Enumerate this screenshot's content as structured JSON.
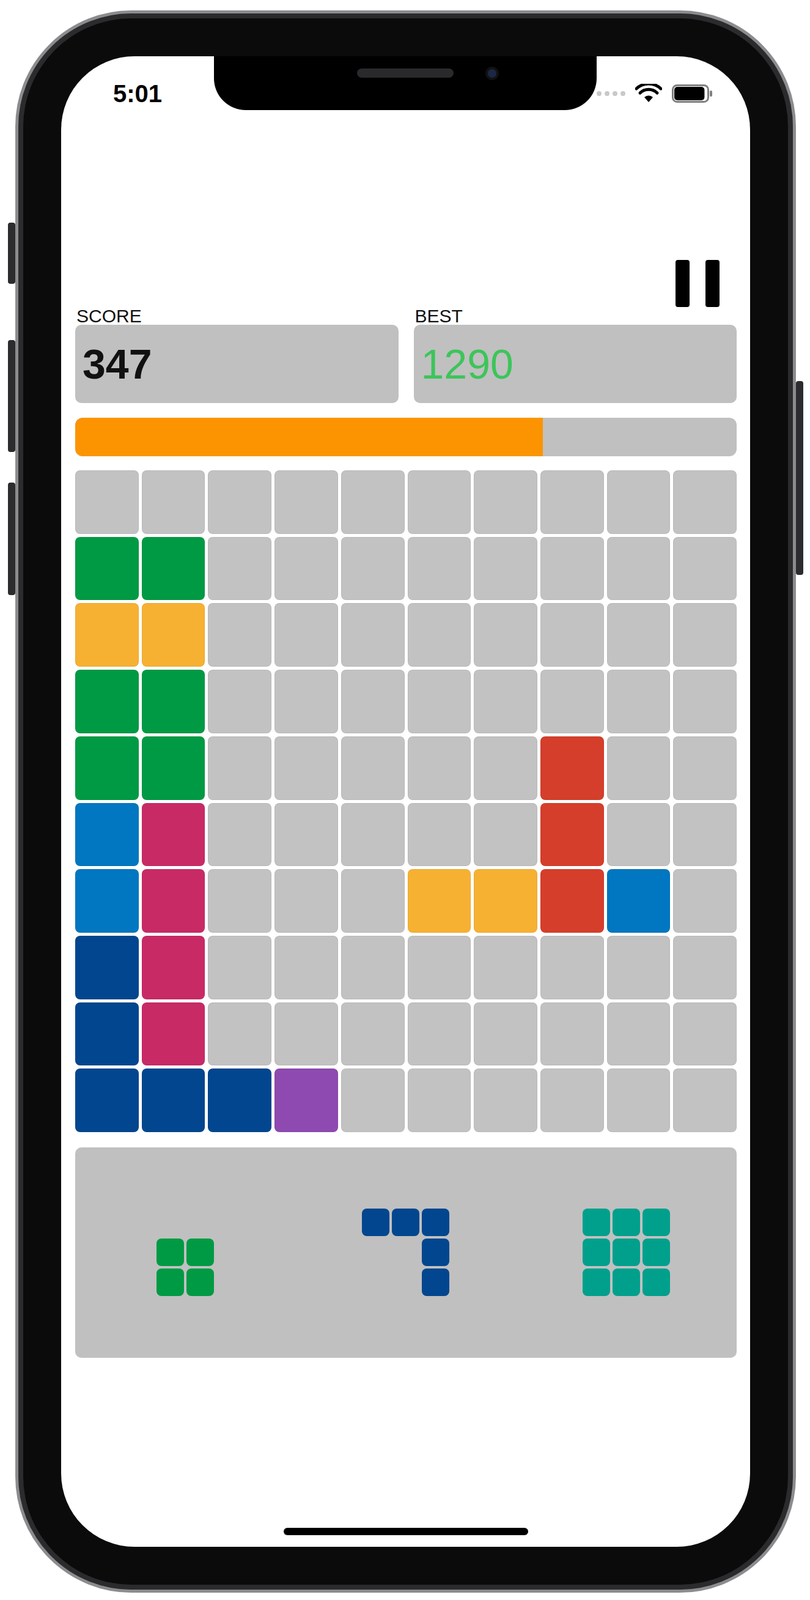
{
  "status_bar": {
    "time": "5:01",
    "battery": {
      "level": 0.95
    }
  },
  "score": {
    "label": "SCORE",
    "value": "347"
  },
  "best": {
    "label": "BEST",
    "value": "1290"
  },
  "progress": {
    "level": 0.707
  },
  "board": {
    "rows": [
      [
        {
          "filled": false
        },
        {
          "filled": false
        },
        {
          "filled": false
        },
        {
          "filled": false
        },
        {
          "filled": false
        },
        {
          "filled": false
        },
        {
          "filled": false
        },
        {
          "filled": false
        },
        {
          "filled": false
        },
        {
          "filled": false
        }
      ],
      [
        {
          "filled": true,
          "color": "#009a44"
        },
        {
          "filled": true,
          "color": "#009a44"
        },
        {
          "filled": false
        },
        {
          "filled": false
        },
        {
          "filled": false
        },
        {
          "filled": false
        },
        {
          "filled": false
        },
        {
          "filled": false
        },
        {
          "filled": false
        },
        {
          "filled": false
        }
      ],
      [
        {
          "filled": true,
          "color": "#f6b133"
        },
        {
          "filled": true,
          "color": "#f6b133"
        },
        {
          "filled": false
        },
        {
          "filled": false
        },
        {
          "filled": false
        },
        {
          "filled": false
        },
        {
          "filled": false
        },
        {
          "filled": false
        },
        {
          "filled": false
        },
        {
          "filled": false
        }
      ],
      [
        {
          "filled": true,
          "color": "#009a44"
        },
        {
          "filled": true,
          "color": "#009a44"
        },
        {
          "filled": false
        },
        {
          "filled": false
        },
        {
          "filled": false
        },
        {
          "filled": false
        },
        {
          "filled": false
        },
        {
          "filled": false
        },
        {
          "filled": false
        },
        {
          "filled": false
        }
      ],
      [
        {
          "filled": true,
          "color": "#009a44"
        },
        {
          "filled": true,
          "color": "#009a44"
        },
        {
          "filled": false
        },
        {
          "filled": false
        },
        {
          "filled": false
        },
        {
          "filled": false
        },
        {
          "filled": false
        },
        {
          "filled": true,
          "color": "#d53e2b"
        },
        {
          "filled": false
        },
        {
          "filled": false
        }
      ],
      [
        {
          "filled": true,
          "color": "#0077c0"
        },
        {
          "filled": true,
          "color": "#c82a66"
        },
        {
          "filled": false
        },
        {
          "filled": false
        },
        {
          "filled": false
        },
        {
          "filled": false
        },
        {
          "filled": false
        },
        {
          "filled": true,
          "color": "#d53e2b"
        },
        {
          "filled": false
        },
        {
          "filled": false
        }
      ],
      [
        {
          "filled": true,
          "color": "#0077c0"
        },
        {
          "filled": true,
          "color": "#c82a66"
        },
        {
          "filled": false
        },
        {
          "filled": false
        },
        {
          "filled": false
        },
        {
          "filled": true,
          "color": "#f6b133"
        },
        {
          "filled": true,
          "color": "#f6b133"
        },
        {
          "filled": true,
          "color": "#d53e2b"
        },
        {
          "filled": true,
          "color": "#0077c0"
        },
        {
          "filled": false
        }
      ],
      [
        {
          "filled": true,
          "color": "#02468f"
        },
        {
          "filled": true,
          "color": "#c82a66"
        },
        {
          "filled": false
        },
        {
          "filled": false
        },
        {
          "filled": false
        },
        {
          "filled": false
        },
        {
          "filled": false
        },
        {
          "filled": false
        },
        {
          "filled": false
        },
        {
          "filled": false
        }
      ],
      [
        {
          "filled": true,
          "color": "#02468f"
        },
        {
          "filled": true,
          "color": "#c82a66"
        },
        {
          "filled": false
        },
        {
          "filled": false
        },
        {
          "filled": false
        },
        {
          "filled": false
        },
        {
          "filled": false
        },
        {
          "filled": false
        },
        {
          "filled": false
        },
        {
          "filled": false
        }
      ],
      [
        {
          "filled": true,
          "color": "#02468f"
        },
        {
          "filled": true,
          "color": "#02468f"
        },
        {
          "filled": true,
          "color": "#02468f"
        },
        {
          "filled": true,
          "color": "#8e4ab0"
        },
        {
          "filled": false
        },
        {
          "filled": false
        },
        {
          "filled": false
        },
        {
          "filled": false
        },
        {
          "filled": false
        },
        {
          "filled": false
        }
      ]
    ]
  },
  "pieces": [
    {
      "color": "#009a44",
      "shape": [
        [
          1,
          1
        ],
        [
          1,
          1
        ]
      ]
    },
    {
      "color": "#02468f",
      "shape": [
        [
          1,
          1,
          1
        ],
        [
          0,
          0,
          1
        ],
        [
          0,
          0,
          1
        ]
      ]
    },
    {
      "color": "#00a08c",
      "shape": [
        [
          1,
          1,
          1
        ],
        [
          1,
          1,
          1
        ],
        [
          1,
          1,
          1
        ]
      ]
    }
  ]
}
